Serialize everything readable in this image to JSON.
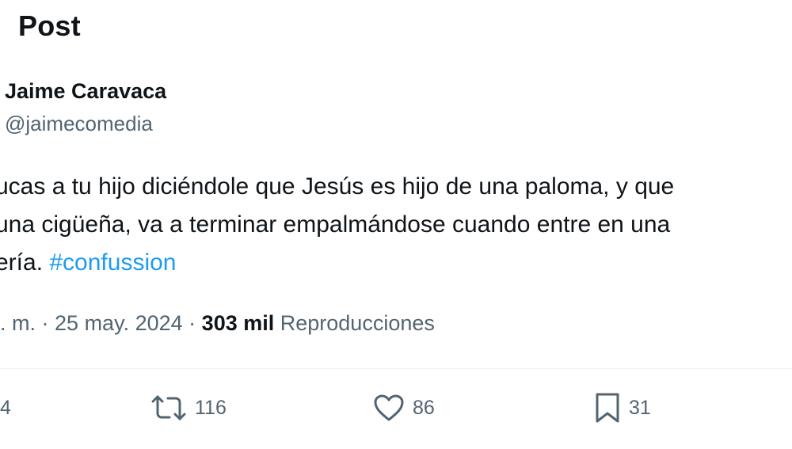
{
  "header": {
    "title": "Post"
  },
  "author": {
    "name": "Jaime Caravaca",
    "handle": "@jaimecomedia"
  },
  "post": {
    "line1": "ucas a tu hijo diciéndole que Jesús es hijo de una paloma, y que",
    "line2": "una cigüeña, va a terminar empalmándose cuando entre en una",
    "line3_prefix": "ería. ",
    "hashtag": "#confussion"
  },
  "meta": {
    "time": ". m.",
    "separator": "·",
    "date": "25 may. 2024",
    "views_count": "303 mil",
    "views_label": "Reproducciones"
  },
  "actions": {
    "replies": "4",
    "reposts": "116",
    "likes": "86",
    "bookmarks": "31"
  },
  "icons": {
    "repost": "repost-icon",
    "like": "heart-icon",
    "bookmark": "bookmark-icon"
  },
  "colors": {
    "text": "#0f1419",
    "secondary": "#536471",
    "link": "#1d9bf0",
    "divider": "#eff3f4"
  }
}
